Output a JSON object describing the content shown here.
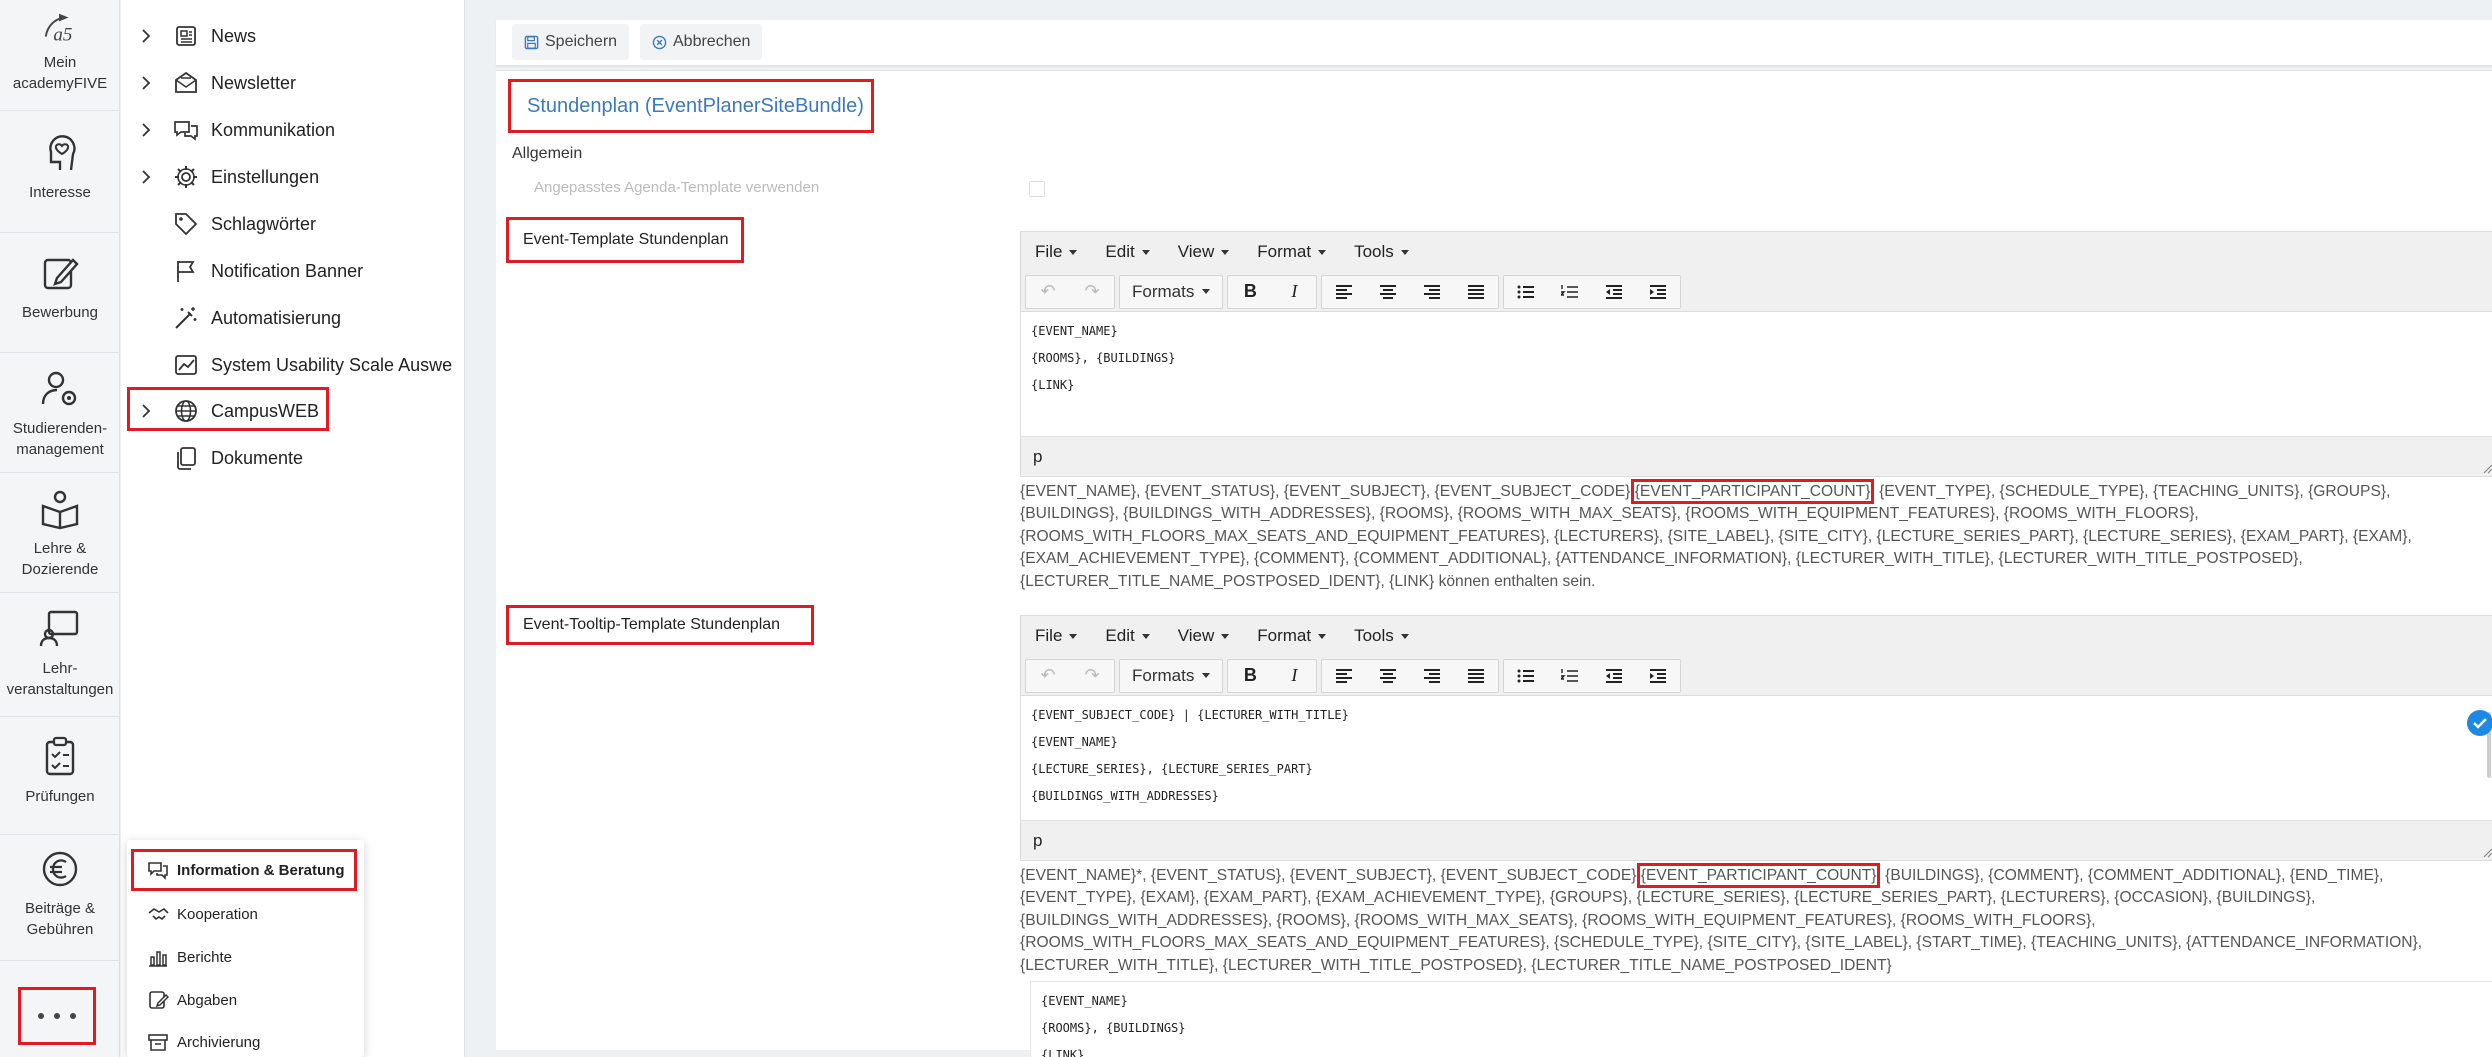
{
  "rail": {
    "items": [
      {
        "label": "Mein academyFIVE"
      },
      {
        "label": "Interesse"
      },
      {
        "label": "Bewerbung"
      },
      {
        "label": "Studierenden-management"
      },
      {
        "label": "Lehre & Dozierende"
      },
      {
        "label": "Lehr-veranstaltungen"
      },
      {
        "label": "Prüfungen"
      },
      {
        "label": "Beiträge & Gebühren"
      }
    ],
    "brand": "a5"
  },
  "nav": {
    "items": [
      {
        "label": "News",
        "icon": "newspaper-icon",
        "expandable": true
      },
      {
        "label": "Newsletter",
        "icon": "newsletter-icon",
        "expandable": true
      },
      {
        "label": "Kommunikation",
        "icon": "chat-icon",
        "expandable": true
      },
      {
        "label": "Einstellungen",
        "icon": "gear-icon",
        "expandable": true
      },
      {
        "label": "Schlagwörter",
        "icon": "tag-icon",
        "expandable": false
      },
      {
        "label": "Notification Banner",
        "icon": "flag-icon",
        "expandable": false
      },
      {
        "label": "Automatisierung",
        "icon": "magic-wand-icon",
        "expandable": false
      },
      {
        "label": "System Usability Scale Auswe",
        "icon": "chart-icon",
        "expandable": false
      },
      {
        "label": "CampusWEB",
        "icon": "globe-icon",
        "expandable": true
      },
      {
        "label": "Dokumente",
        "icon": "documents-icon",
        "expandable": false
      }
    ]
  },
  "popup": {
    "items": [
      {
        "label": "Information & Beratung"
      },
      {
        "label": "Kooperation"
      },
      {
        "label": "Berichte"
      },
      {
        "label": "Abgaben"
      },
      {
        "label": "Archivierung"
      }
    ]
  },
  "toolbar": {
    "save_label": "Speichern",
    "cancel_label": "Abbrechen"
  },
  "section": {
    "title": "Stundenplan (EventPlanerSiteBundle)",
    "group": "Allgemein",
    "faded_label": "Angepasstes Agenda-Template verwenden"
  },
  "editor_menu": {
    "file": "File",
    "edit": "Edit",
    "view": "View",
    "format": "Format",
    "tools": "Tools",
    "formats": "Formats"
  },
  "field1": {
    "label": "Event-Template Stundenplan",
    "lines": [
      "{EVENT_NAME}",
      "{ROOMS}, {BUILDINGS}",
      "{LINK}"
    ],
    "status": "p",
    "help_before": "{EVENT_NAME}, {EVENT_STATUS}, {EVENT_SUBJECT}, {EVENT_SUBJECT_CODE},",
    "help_highlight": "{EVENT_PARTICIPANT_COUNT}",
    "help_after": ", {EVENT_TYPE}, {SCHEDULE_TYPE}, {TEACHING_UNITS}, {GROUPS}, {BUILDINGS}, {BUILDINGS_WITH_ADDRESSES}, {ROOMS}, {ROOMS_WITH_MAX_SEATS}, {ROOMS_WITH_EQUIPMENT_FEATURES}, {ROOMS_WITH_FLOORS}, {ROOMS_WITH_FLOORS_MAX_SEATS_AND_EQUIPMENT_FEATURES}, {LECTURERS}, {SITE_LABEL}, {SITE_CITY}, {LECTURE_SERIES_PART}, {LECTURE_SERIES}, {EXAM_PART}, {EXAM}, {EXAM_ACHIEVEMENT_TYPE}, {COMMENT}, {COMMENT_ADDITIONAL}, {ATTENDANCE_INFORMATION}, {LECTURER_WITH_TITLE}, {LECTURER_WITH_TITLE_POSTPOSED}, {LECTURER_TITLE_NAME_POSTPOSED_IDENT}, {LINK} können enthalten sein."
  },
  "field2": {
    "label": "Event-Tooltip-Template Stundenplan",
    "lines": [
      "{EVENT_SUBJECT_CODE} | {LECTURER_WITH_TITLE}",
      "{EVENT_NAME}",
      "{LECTURE_SERIES}, {LECTURE_SERIES_PART}",
      "{BUILDINGS_WITH_ADDRESSES}"
    ],
    "status": "p",
    "help_before": "{EVENT_NAME}*, {EVENT_STATUS}, {EVENT_SUBJECT}, {EVENT_SUBJECT_CODE},",
    "help_highlight": "{EVENT_PARTICIPANT_COUNT}",
    "help_after": ", {BUILDINGS}, {COMMENT}, {COMMENT_ADDITIONAL}, {END_TIME}, {EVENT_TYPE}, {EXAM}, {EXAM_PART}, {EXAM_ACHIEVEMENT_TYPE}, {GROUPS}, {LECTURE_SERIES}, {LECTURE_SERIES_PART}, {LECTURERS}, {OCCASION}, {BUILDINGS}, {BUILDINGS_WITH_ADDRESSES}, {ROOMS}, {ROOMS_WITH_MAX_SEATS}, {ROOMS_WITH_EQUIPMENT_FEATURES}, {ROOMS_WITH_FLOORS}, {ROOMS_WITH_FLOORS_MAX_SEATS_AND_EQUIPMENT_FEATURES}, {SCHEDULE_TYPE}, {SITE_CITY}, {SITE_LABEL}, {START_TIME}, {TEACHING_UNITS}, {ATTENDANCE_INFORMATION}, {LECTURER_WITH_TITLE}, {LECTURER_WITH_TITLE_POSTPOSED}, {LECTURER_TITLE_NAME_POSTPOSED_IDENT}"
  },
  "field3": {
    "lines": [
      "{EVENT_NAME}",
      "{ROOMS}, {BUILDINGS}",
      "{LINK}"
    ]
  },
  "colors": {
    "highlight": "#e11b22",
    "accent": "#3a7abf",
    "check": "#1e88e5"
  }
}
